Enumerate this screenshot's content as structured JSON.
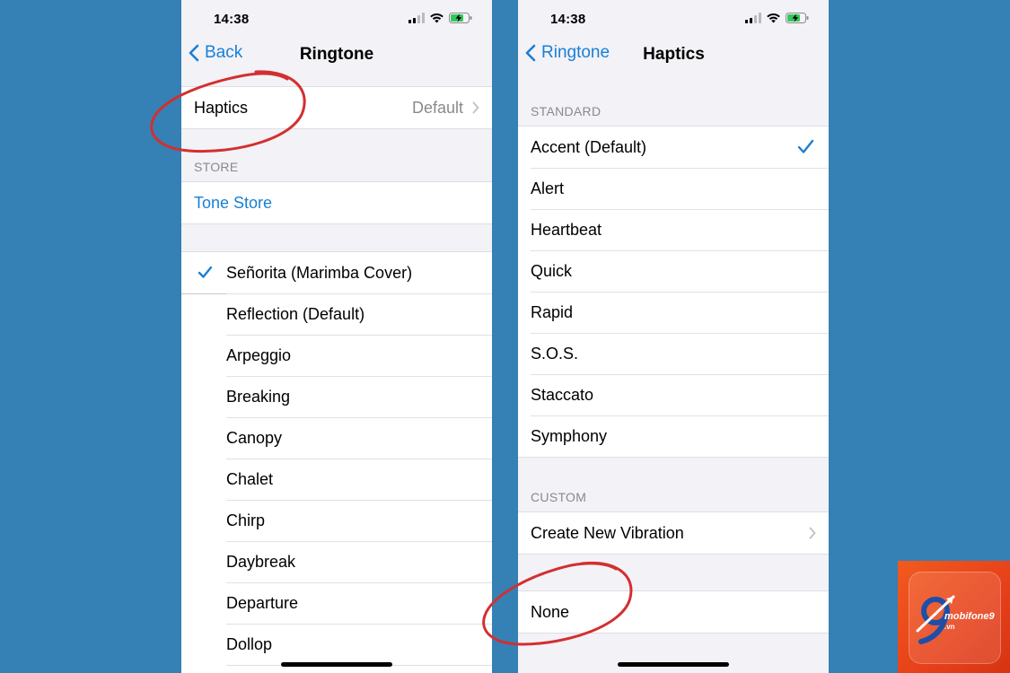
{
  "colors": {
    "background": "#3580b4",
    "accent": "#1a7fd4",
    "annotation": "#d32f2f"
  },
  "left_screen": {
    "status_time": "14:38",
    "back_label": "Back",
    "title": "Ringtone",
    "haptics": {
      "label": "Haptics",
      "value": "Default"
    },
    "store_header": "STORE",
    "tone_store": "Tone Store",
    "tones": [
      "Señorita (Marimba Cover)",
      "Reflection (Default)",
      "Arpeggio",
      "Breaking",
      "Canopy",
      "Chalet",
      "Chirp",
      "Daybreak",
      "Departure",
      "Dollop"
    ],
    "selected_tone": "Señorita (Marimba Cover)"
  },
  "right_screen": {
    "status_time": "14:38",
    "back_label": "Ringtone",
    "title": "Haptics",
    "standard_header": "STANDARD",
    "standard": [
      "Accent (Default)",
      "Alert",
      "Heartbeat",
      "Quick",
      "Rapid",
      "S.O.S.",
      "Staccato",
      "Symphony"
    ],
    "selected_haptic": "Accent (Default)",
    "custom_header": "CUSTOM",
    "create_new": "Create New Vibration",
    "none_label": "None"
  },
  "watermark": {
    "brand": "mobifone9",
    "tld": ".vn"
  },
  "icons": [
    "signal-icon",
    "wifi-icon",
    "battery-charging-icon",
    "chevron-left-icon",
    "chevron-right-icon",
    "checkmark-icon"
  ]
}
